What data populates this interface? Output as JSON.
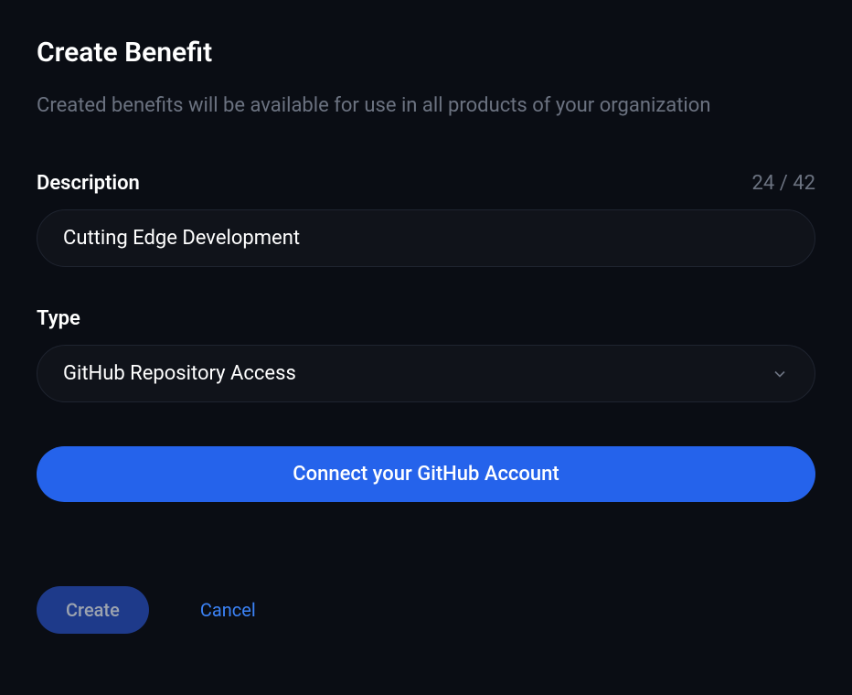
{
  "header": {
    "title": "Create Benefit",
    "subtitle": "Created benefits will be available for use in all products of your organization"
  },
  "form": {
    "description": {
      "label": "Description",
      "value": "Cutting Edge Development",
      "counter": "24 / 42"
    },
    "type": {
      "label": "Type",
      "value": "GitHub Repository Access"
    },
    "connect_button": "Connect your GitHub Account"
  },
  "actions": {
    "create": "Create",
    "cancel": "Cancel"
  }
}
